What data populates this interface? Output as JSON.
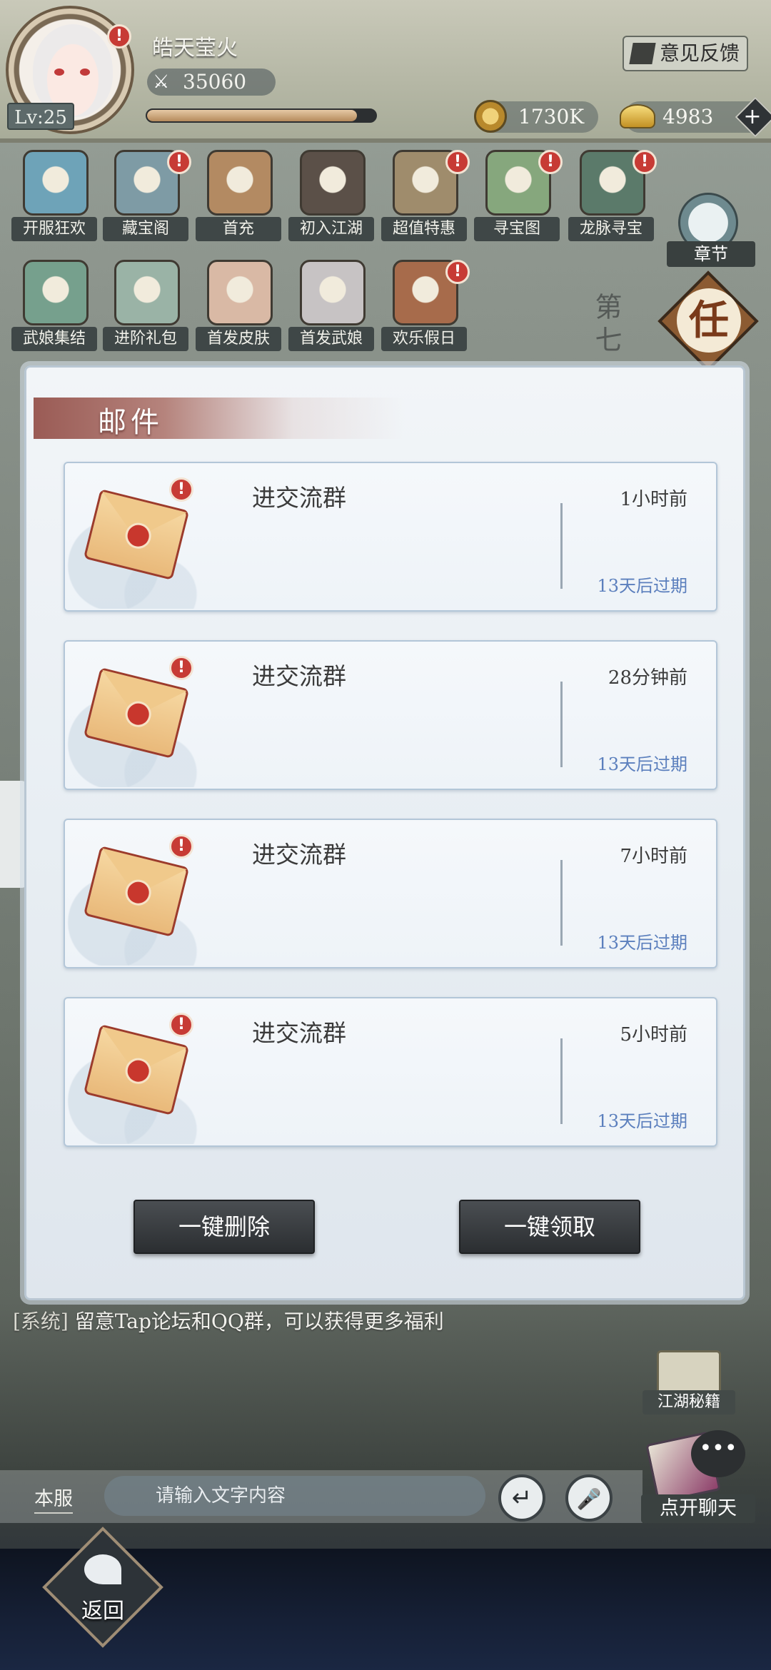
{
  "header": {
    "player_name": "皓天莹火",
    "level": "Lv:25",
    "power": "35060",
    "exp_fraction": 0.92,
    "feedback_label": "意见反馈",
    "copper": "1730K",
    "gold": "4983"
  },
  "events": [
    {
      "label": "开服狂欢",
      "icon": "scroll-icon",
      "alert": false,
      "color": "#6ea3b8"
    },
    {
      "label": "藏宝阁",
      "icon": "pavilion-icon",
      "alert": true,
      "color": "#7e9ba5"
    },
    {
      "label": "首充",
      "icon": "gift-box-icon",
      "alert": false,
      "color": "#b38a62"
    },
    {
      "label": "初入江湖",
      "icon": "yin-yang-chest-icon",
      "alert": false,
      "color": "#5b5048"
    },
    {
      "label": "超值特惠",
      "icon": "treasure-pot-icon",
      "alert": true,
      "color": "#9f8c6c"
    },
    {
      "label": "寻宝图",
      "icon": "treasure-map-icon",
      "alert": true,
      "color": "#86a77d"
    },
    {
      "label": "龙脉寻宝",
      "icon": "compass-icon",
      "alert": true,
      "color": "#5b7a6a"
    },
    {
      "label": "武娘集结",
      "icon": "token-icon",
      "alert": false,
      "color": "#76a08d"
    },
    {
      "label": "进阶礼包",
      "icon": "gift-bag-icon",
      "alert": false,
      "color": "#9ab3a6"
    },
    {
      "label": "首发皮肤",
      "icon": "heroine-portrait-icon",
      "alert": false,
      "color": "#d9b9a5"
    },
    {
      "label": "首发武娘",
      "icon": "heroine-portrait-icon",
      "alert": false,
      "color": "#c7c3c4"
    },
    {
      "label": "欢乐假日",
      "icon": "lantern-icon",
      "alert": true,
      "color": "#a76b4b"
    }
  ],
  "side": {
    "chapter_label": "章节",
    "task_glyph": "任",
    "chapter_text": "第七"
  },
  "mail": {
    "title": "邮件",
    "items": [
      {
        "subject": "进交流群",
        "time": "1小时前",
        "expire": "13天后过期"
      },
      {
        "subject": "进交流群",
        "time": "28分钟前",
        "expire": "13天后过期"
      },
      {
        "subject": "进交流群",
        "time": "7小时前",
        "expire": "13天后过期"
      },
      {
        "subject": "进交流群",
        "time": "5小时前",
        "expire": "13天后过期"
      }
    ],
    "delete_all_label": "一键删除",
    "claim_all_label": "一键领取"
  },
  "chat": {
    "system_tag": "[系统]",
    "system_message": "留意Tap论坛和QQ群，可以获得更多福利",
    "tips_label": "江湖秘籍",
    "server_label": "本服",
    "input_placeholder": "请输入文字内容",
    "send_glyph": "↵",
    "voice_glyph": "🎤",
    "open_chat_label": "点开聊天",
    "bubble_glyph": "•••"
  },
  "footer": {
    "back_label": "返回"
  },
  "colors": {
    "expire_text": "#5b7fbd",
    "alert_red": "#c73b35",
    "title_bar": "#9a5b55"
  }
}
